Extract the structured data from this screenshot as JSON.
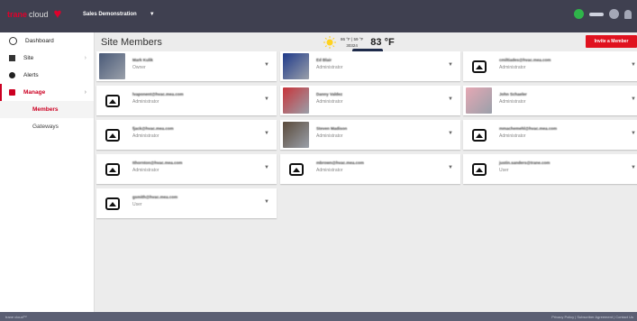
{
  "header": {
    "brand": "trane",
    "cloud": "cloud",
    "site_name": "Sales Demonstration"
  },
  "colors": {
    "accent": "#e0121f",
    "topbar": "#3f4050",
    "globe": "#2fb44a"
  },
  "sidebar": {
    "items": [
      {
        "label": "Dashboard",
        "icon": "dashboard-icon"
      },
      {
        "label": "Site",
        "icon": "building-icon"
      },
      {
        "label": "Alerts",
        "icon": "alert-icon"
      },
      {
        "label": "Manage",
        "icon": "manage-icon"
      }
    ],
    "sub_items": [
      {
        "label": "Members",
        "active": true
      },
      {
        "label": "Gateways",
        "active": false
      }
    ]
  },
  "page": {
    "title": "Site Members",
    "invite_label": "Invite a Member"
  },
  "weather": {
    "high_low": "86 °F | 59 °F",
    "zip": "30324",
    "current": "83 °F",
    "icon": "sun-icon"
  },
  "members": [
    {
      "name": "Mark Kulik",
      "role": "Owner",
      "photo": "photo"
    },
    {
      "name": "Ed Blair",
      "role": "Administrator",
      "photo": "photo"
    },
    {
      "name": "cmiltiades@hvac.mea.com",
      "role": "Administrator",
      "photo": "generic"
    },
    {
      "name": "lvaponent@hvac.mea.com",
      "role": "Administrator",
      "photo": "generic"
    },
    {
      "name": "Danny Valdez",
      "role": "Administrator",
      "photo": "photo"
    },
    {
      "name": "John Schaeler",
      "role": "Administrator",
      "photo": "photo"
    },
    {
      "name": "fjack@hvac.mea.com",
      "role": "Administrator",
      "photo": "generic"
    },
    {
      "name": "Steven Madison",
      "role": "Administrator",
      "photo": "photo"
    },
    {
      "name": "mmachemehl@hvac.mea.com",
      "role": "Administrator",
      "photo": "generic"
    },
    {
      "name": "tthornton@hvac.mea.com",
      "role": "Administrator",
      "photo": "generic"
    },
    {
      "name": "mbrown@hvac.mea.com",
      "role": "Administrator",
      "photo": "generic"
    },
    {
      "name": "justin.sanders@trane.com",
      "role": "User",
      "photo": "generic"
    },
    {
      "name": "gsmith@hvac.mea.com",
      "role": "User",
      "photo": "generic"
    }
  ],
  "footer": {
    "left": "trane cloud™",
    "right": "Privacy Policy | Subscriber Agreement | Contact Us"
  }
}
